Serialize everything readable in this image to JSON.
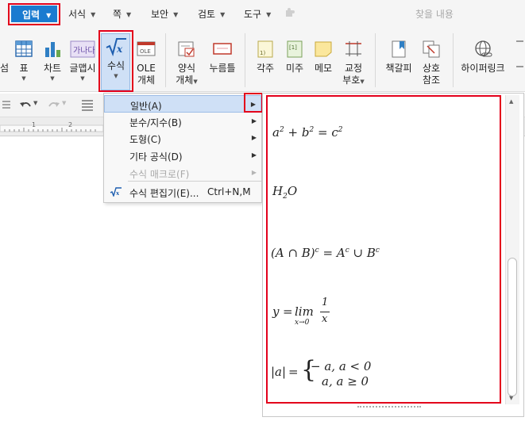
{
  "menubar": {
    "active": "입력",
    "items": [
      "서식",
      "쪽",
      "보안",
      "검토",
      "도구"
    ],
    "search_placeholder": "찾을 내용"
  },
  "ribbon": {
    "buttons": [
      "표",
      "차트",
      "글맵시",
      "수식",
      "OLE",
      "개체",
      "양식",
      "개체",
      "누름틀",
      "각주",
      "미주",
      "메모",
      "교정",
      "부호",
      "책갈피",
      "상호",
      "참조",
      "하이퍼링크"
    ]
  },
  "dropdown": {
    "items": [
      "일반(A)",
      "분수/지수(B)",
      "도형(C)",
      "기타 공식(D)",
      "수식 매크로(F)",
      "수식 편집기(E)...",
      "Ctrl+N,M"
    ]
  },
  "ruler": {
    "marks": [
      "1",
      "2"
    ]
  },
  "gallery": {
    "eq1": {
      "a": "a",
      "sa": "2",
      "plus": "+",
      "b": "b",
      "sb": "2",
      "eq": "=",
      "c": "c",
      "sc": "2"
    },
    "eq2": {
      "h": "H",
      "sub": "2",
      "o": "O"
    },
    "eq3": {
      "lhs": "(A ∩ B)",
      "slhs": "c",
      "eq": "=",
      "a": "A",
      "sa": "c",
      "cup": "∪",
      "b": "B",
      "sb": "c"
    },
    "eq4": {
      "y": "y",
      "eq": "=",
      "lim": "lim",
      "under": "x→0",
      "num": "1",
      "den": "x"
    },
    "eq5": {
      "abs": "|a|",
      "eq": "=",
      "brace": "{",
      "row1": "− a, a < 0",
      "row2": "a, a ≥ 0"
    }
  }
}
